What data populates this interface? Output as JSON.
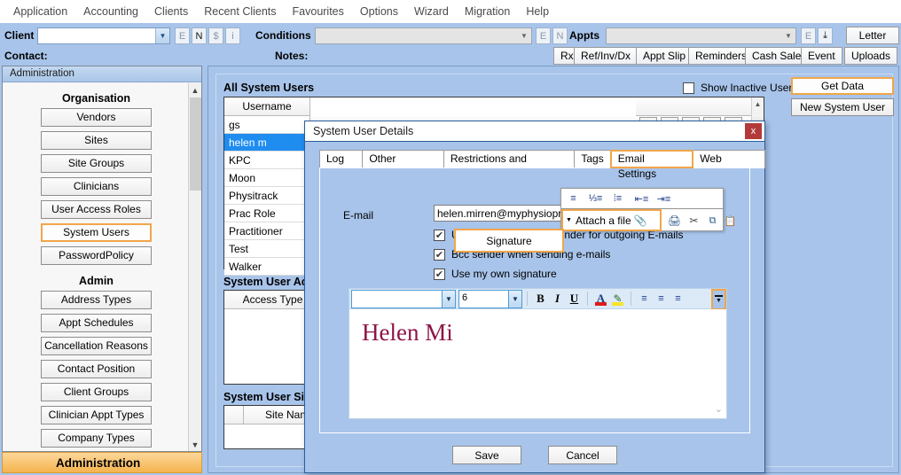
{
  "menubar": [
    "Application",
    "Accounting",
    "Clients",
    "Recent Clients",
    "Favourites",
    "Options",
    "Wizard",
    "Migration",
    "Help"
  ],
  "toolbar": {
    "client_label": "Client",
    "client_value": "",
    "client_buttons": [
      "E",
      "N",
      "$",
      "i"
    ],
    "conditions_label": "Conditions",
    "conditions_value": "",
    "conditions_buttons": [
      "E",
      "N"
    ],
    "appts_label": "Appts",
    "appts_value": "",
    "appts_buttons": [
      "E"
    ],
    "download_icon": "download-icon",
    "letter_button": "Letter",
    "contact_label": "Contact:",
    "notes_label": "Notes:",
    "action_buttons": [
      "Rx",
      "Ref/Inv/Dx",
      "Appt Slip",
      "Reminders",
      "Cash Sale",
      "Event",
      "Uploads"
    ]
  },
  "nav": {
    "header": "Administration",
    "groups": [
      {
        "title": "Organisation",
        "items": [
          "Vendors",
          "Sites",
          "Site Groups",
          "Clinicians",
          "User Access Roles",
          "System Users",
          "PasswordPolicy"
        ],
        "selected": "System Users"
      },
      {
        "title": "Admin",
        "items": [
          "Address Types",
          "Appt Schedules",
          "Cancellation Reasons",
          "Contact Position",
          "Client Groups",
          "Clinician Appt Types",
          "Company Types"
        ],
        "selected": ""
      }
    ],
    "footer": "Administration"
  },
  "main": {
    "users_title": "All System Users",
    "show_inactive_label": "Show Inactive Users",
    "show_inactive_checked": false,
    "get_data_button": "Get Data",
    "new_user_button": "New System User",
    "username_header": "Username",
    "usernames": [
      "gs",
      "helen m",
      "KPC",
      "Moon",
      "Physitrack",
      "Prac Role",
      "Practitioner",
      "Test",
      "Walker"
    ],
    "selected_username": "helen m",
    "access_title": "System User Access",
    "access_header": "Access Type",
    "sites_title": "System User Sites",
    "sites_header": "Site Name",
    "row_icons": [
      "pencil-icon",
      "plus-icon",
      "plus-icon",
      "plus-icon",
      "delete-icon"
    ]
  },
  "dialog": {
    "title": "System User Details",
    "close_label": "x",
    "tabs": [
      "Log In",
      "Other Settings",
      "Restrictions and Security",
      "Tags",
      "Email Settings",
      "Web Access"
    ],
    "active_tab": "Email Settings",
    "email_label": "E-mail",
    "email_value": "helen.mirren@myphysiopractice.com",
    "checkboxes": [
      {
        "label": "Use Gensolve e-mail sender for outgoing E-mails",
        "checked": true
      },
      {
        "label": "Bcc sender when sending e-mails",
        "checked": true
      },
      {
        "label": "Use my  own signature",
        "checked": true
      }
    ],
    "editor": {
      "font_family_value": "",
      "font_size_value": "6",
      "tools": [
        "bold",
        "italic",
        "underline",
        "font-color",
        "highlight",
        "align-left",
        "align-center",
        "align-right"
      ],
      "overflow_tools": [
        "justify",
        "numbered-list",
        "bulleted-list",
        "decrease-indent",
        "increase-indent"
      ],
      "attach_label": "Attach a file",
      "attach_tools": [
        "print-icon",
        "cut-icon",
        "copy-icon",
        "paste-icon"
      ],
      "signature_text": "Helen Mi",
      "more_button": "more-toolbar-button"
    },
    "callouts": {
      "signature": "Signature"
    },
    "save_button": "Save",
    "cancel_button": "Cancel"
  }
}
